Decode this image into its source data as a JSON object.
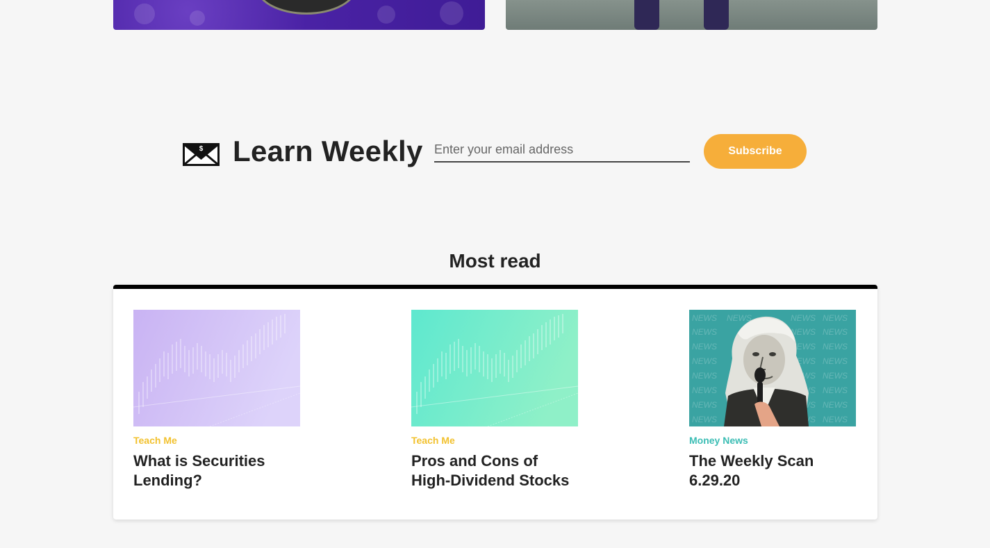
{
  "newsletter": {
    "title": "Learn Weekly",
    "email_placeholder": "Enter your email address",
    "subscribe_label": "Subscribe",
    "icon": "envelope-dollar-icon"
  },
  "most_read": {
    "title": "Most read",
    "articles": [
      {
        "category": "Teach Me",
        "category_color": "#f2c12e",
        "title_line1": "What is Securities",
        "title_line2": "Lending?",
        "image": "purple-stock-chart"
      },
      {
        "category": "Teach Me",
        "category_color": "#f2c12e",
        "title_line1": "Pros and Cons of",
        "title_line2": "High-Dividend Stocks",
        "image": "teal-stock-chart"
      },
      {
        "category": "Money News",
        "category_color": "#3bbdb4",
        "title_line1": "The Weekly Scan",
        "title_line2": "6.29.20",
        "image": "washington-news-microphone",
        "image_text": "NEWS"
      }
    ]
  },
  "colors": {
    "accent": "#f6ae3a",
    "background": "#f6f6f6",
    "panel_border": "#000000"
  }
}
